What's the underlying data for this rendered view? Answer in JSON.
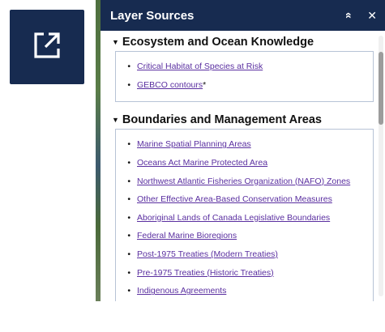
{
  "launch_button": {
    "icon": "external-link-icon"
  },
  "panel": {
    "title": "Layer Sources",
    "collapse_icon": "«",
    "close_icon": "✕"
  },
  "sections": [
    {
      "title": "Ecosystem and Ocean Knowledge",
      "items": [
        {
          "label": "Critical Habitat of Species at Risk",
          "suffix": ""
        },
        {
          "label": "GEBCO contours",
          "suffix": "*"
        }
      ]
    },
    {
      "title": "Boundaries and Management Areas",
      "items": [
        {
          "label": "Marine Spatial Planning Areas",
          "suffix": ""
        },
        {
          "label": "Oceans Act Marine Protected Area",
          "suffix": ""
        },
        {
          "label": "Northwest Atlantic Fisheries Organization (NAFO) Zones",
          "suffix": ""
        },
        {
          "label": "Other Effective Area-Based Conservation Measures",
          "suffix": ""
        },
        {
          "label": "Aboriginal Lands of Canada Legislative Boundaries",
          "suffix": ""
        },
        {
          "label": "Federal Marine Bioregions",
          "suffix": ""
        },
        {
          "label": "Post-1975 Treaties (Modern Treaties)",
          "suffix": ""
        },
        {
          "label": "Pre-1975 Treaties (Historic Treaties)",
          "suffix": ""
        },
        {
          "label": "Indigenous Agreements",
          "suffix": ""
        }
      ]
    }
  ],
  "colors": {
    "header_bg": "#172b50",
    "link": "#5a2fa0",
    "box_border": "#b7c3d6"
  }
}
